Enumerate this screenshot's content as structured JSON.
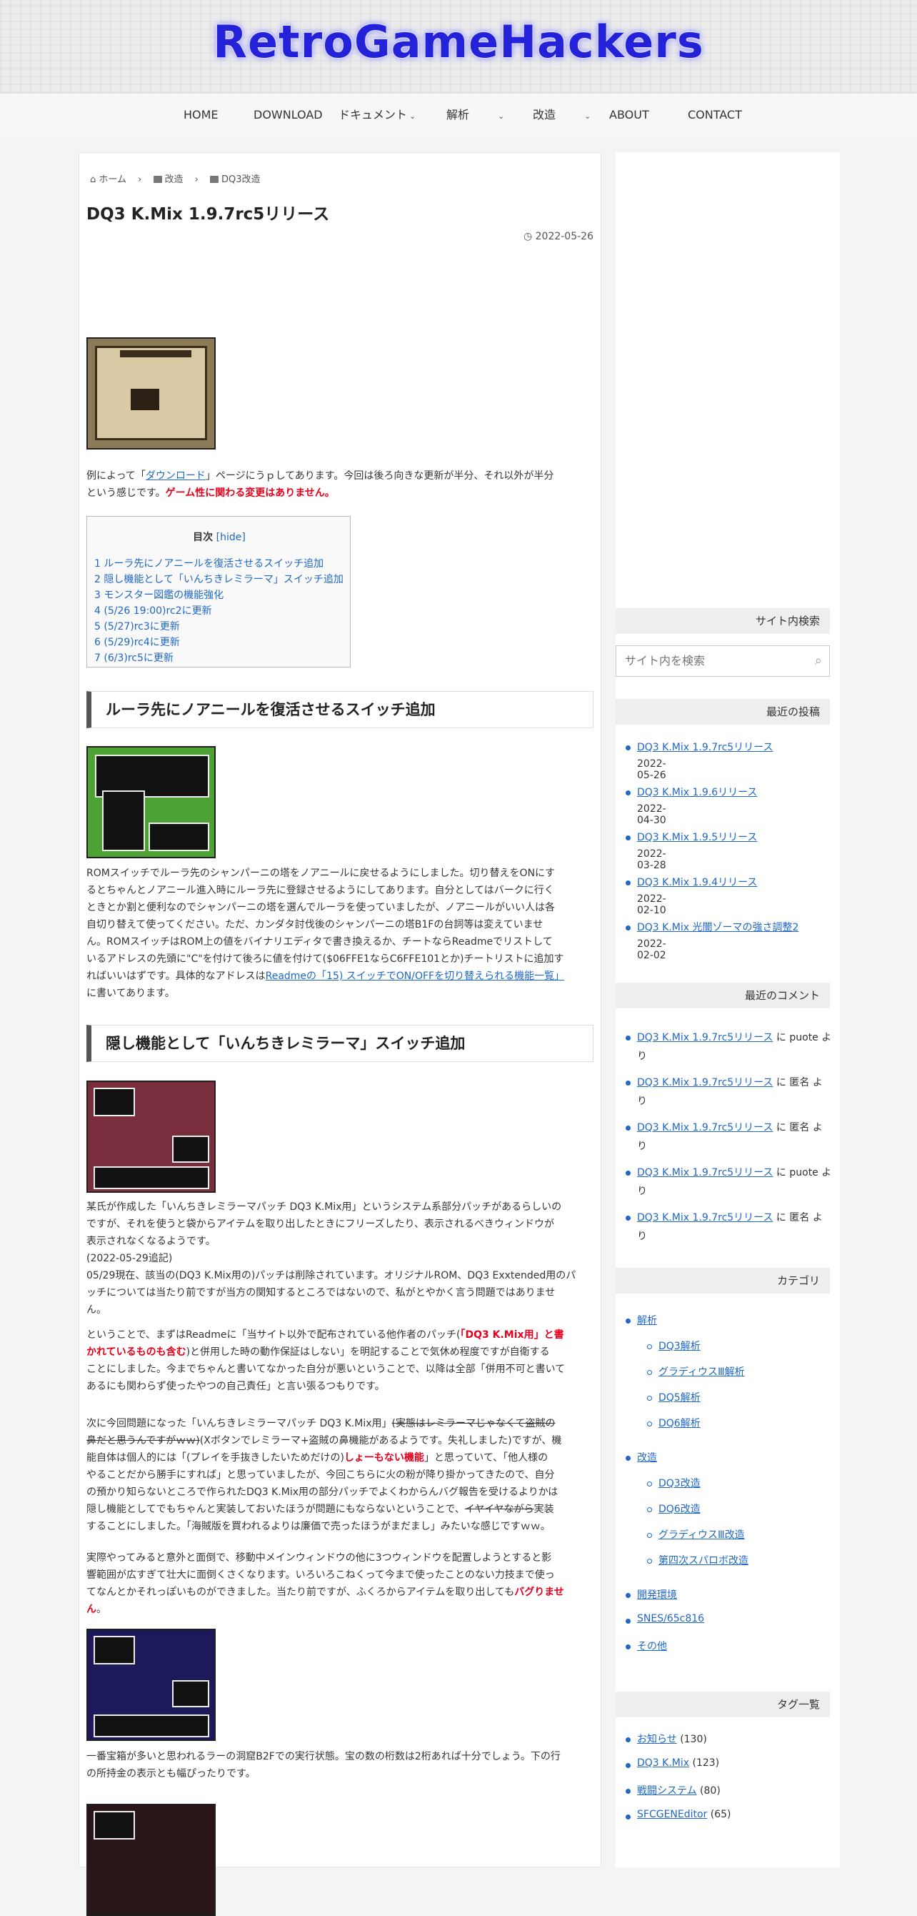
{
  "site": {
    "logo": "RetroGameHackers"
  },
  "nav": [
    {
      "label": "HOME"
    },
    {
      "label": "DOWNLOAD"
    },
    {
      "label": "ドキュメント"
    },
    {
      "label": "解析"
    },
    {
      "label": "改造"
    },
    {
      "label": "ABOUT"
    },
    {
      "label": "CONTACT"
    }
  ],
  "breadcrumb": {
    "home": "ホーム",
    "cat": "改造",
    "sub": "DQ3改造"
  },
  "post": {
    "title": "DQ3 K.Mix 1.9.7rc5リリース",
    "date": "2022-05-26",
    "intro_1": "例によって「",
    "intro_link": "ダウンロード",
    "intro_2": "」ページにうｐしてあります。今回は後ろ向きな更新が半分、それ以外が半分",
    "intro_3": "という感じです。",
    "intro_red": "ゲーム性に関わる変更はありません。",
    "toc": {
      "title": "目次",
      "hide": "[hide]",
      "items": [
        "1 ルーラ先にノアニールを復活させるスイッチ追加",
        "2 隠し機能として「いんちきレミラーマ」スイッチ追加",
        "3 モンスター図鑑の機能強化",
        "4 (5/26 19:00)rc2に更新",
        "5 (5/27)rc3に更新",
        "6 (5/29)rc4に更新",
        "7 (6/3)rc5に更新"
      ]
    },
    "h2_1": "ルーラ先にノアニールを復活させるスイッチ追加",
    "s1_lines": [
      "ROMスイッチでルーラ先のシャンパーニの塔をノアニールに戻せるようにしました。切り替えをONにす",
      "るとちゃんとノアニール進入時にルーラ先に登録させるようにしてあります。自分としてはバークに行く",
      "ときとか割と便利なのでシャンパーニの塔を選んでルーラを使っていましたが、ノアニールがいい人は各",
      "自切り替えて使ってください。ただ、カンダタ討伐後のシャンパーニの塔B1Fの台詞等は変えていませ",
      "ん。ROMスイッチはROM上の値をバイナリエディタで書き換えるか、チートならReadmeでリストして",
      "いるアドレスの先頭に\"C\"を付けて後ろに値を付けて($06FFE1ならC6FFE101とか)チートリストに追加す"
    ],
    "s1_l7a": "ればいいはずです。具体的なアドレスは",
    "s1_link": "Readmeの「15) スイッチでON/OFFを切り替えられる機能一覧」",
    "s1_l8": "に書いてあります。",
    "h2_2": "隠し機能として「いんちきレミラーマ」スイッチ追加",
    "s2_lines": [
      "某氏が作成した「いんちきレミラーマパッチ DQ3 K.Mix用」というシステム系部分パッチがあるらしいの",
      "ですが、それを使うと袋からアイテムを取り出したときにフリーズしたり、表示されるべきウィンドウが",
      "表示されなくなるようです。",
      "(2022-05-29追記)",
      "05/29現在、該当の(DQ3 K.Mix用の)パッチは削除されています。オリジナルROM、DQ3 Exxtended用のパ",
      "ッチについては当たり前ですが当方の関知するところではないので、私がとやかく言う問題ではありませ",
      "ん。"
    ],
    "s3_l1a": "ということで、まずはReadmeに「当サイト以外で配布されている他作者のパッチ(",
    "s3_l1red": "「DQ3 K.Mix用」と書",
    "s3_l2red": "かれているものも含む",
    "s3_l2b": ")と併用した時の動作保証はしない」を明記することで気休め程度ですが自衛する",
    "s3_l3": "ことにしました。今までちゃんと書いてなかった自分が悪いということで、以降は全部「併用不可と書いて",
    "s3_l4": "あるにも関わらず使ったやつの自己責任」と言い張るつもりです。",
    "s4_l1a": "次に今回問題になった「いんちきレミラーマパッチ DQ3 K.Mix用」",
    "s4_l1s": "(実態はレミラーマじゃなくて盗賊の",
    "s4_l2s": "鼻だと思うんですがｗｗ)",
    "s4_l2b": "(Xボタンでレミラーマ+盗賊の鼻機能があるようです。失礼しました)ですが、機",
    "s4_l3a": "能自体は個人的には「(プレイを手抜きしたいためだけの)",
    "s4_l3red": "しょーもない機能",
    "s4_l3b": "」と思っていて、「他人様の",
    "s4_l4": "やることだから勝手にすれば」と思っていましたが、今回こちらに火の粉が降り掛かってきたので、自分",
    "s4_l5": "の預かり知らないところで作られたDQ3 K.Mix用の部分パッチでよくわからんバグ報告を受けるよりかは",
    "s4_l6a": "隠し機能としてでもちゃんと実装しておいたほうが問題にもならないということで、",
    "s4_l6s": "イヤイヤながら",
    "s4_l6b": "実装",
    "s4_l7": "することにしました。「海賊版を買われるよりは廉価で売ったほうがまだまし」みたいな感じですｗｗ。",
    "s5_l1": "実際やってみると意外と面倒で、移動中メインウィンドウの他に3つウィンドウを配置しようとすると影",
    "s5_l2": "響範囲が広すぎて壮大に面倒くさくなります。いろいろこねくって今まで使ったことのない力技まで使っ",
    "s5_l3a": "てなんとかそれっぽいものができました。当たり前ですが、ふくろからアイテムを取り出しても",
    "s5_l3red": "バグりませ",
    "s5_l4red": "ん",
    "s5_l4b": "。",
    "s6_l1": "一番宝箱が多いと思われるラーの洞窟B2Fでの実行状態。宝の数の桁数は2桁あれば十分でしょう。下の行",
    "s6_l2": "の所持金の表示とも幅ぴったりです。"
  },
  "sidebar": {
    "search_head": "サイト内検索",
    "search_placeholder": "サイト内を検索",
    "recent_head": "最近の投稿",
    "recent": [
      {
        "title": "DQ3 K.Mix 1.9.7rc5リリース",
        "date": "2022-05-26"
      },
      {
        "title": "DQ3 K.Mix 1.9.6リリース",
        "date": "2022-04-30"
      },
      {
        "title": "DQ3 K.Mix 1.9.5リリース",
        "date": "2022-03-28"
      },
      {
        "title": "DQ3 K.Mix 1.9.4リリース",
        "date": "2022-02-10"
      },
      {
        "title": "DQ3 K.Mix 光闇ゾーマの強さ調整2",
        "date": "2022-02-02"
      }
    ],
    "comments_head": "最近のコメント",
    "comments": [
      {
        "link": "DQ3 K.Mix 1.9.7rc5リリース",
        "by": "に puote よ",
        "tail": "り"
      },
      {
        "link": "DQ3 K.Mix 1.9.7rc5リリース",
        "by": "に 匿名 よ",
        "tail": "り"
      },
      {
        "link": "DQ3 K.Mix 1.9.7rc5リリース",
        "by": "に 匿名 よ",
        "tail": "り"
      },
      {
        "link": "DQ3 K.Mix 1.9.7rc5リリース",
        "by": "に puote よ",
        "tail": "り"
      },
      {
        "link": "DQ3 K.Mix 1.9.7rc5リリース",
        "by": "に 匿名 よ",
        "tail": "り"
      }
    ],
    "cat_head": "カテゴリ",
    "cats": {
      "analysis": "解析",
      "analysis_sub": [
        "DQ3解析",
        "グラディウスⅢ解析",
        "DQ5解析",
        "DQ6解析"
      ],
      "mod": "改造",
      "mod_sub": [
        "DQ3改造",
        "DQ6改造",
        "グラディウスⅢ改造",
        "第四次スパロボ改造"
      ],
      "dev": "開発環境",
      "snes": "SNES/65c816",
      "other": "その他"
    },
    "tag_head": "タグ一覧",
    "tags": [
      {
        "name": "お知らせ",
        "count": "(130)"
      },
      {
        "name": "DQ3 K.Mix",
        "count": "(123)"
      },
      {
        "name": "戦闘システム",
        "count": "(80)"
      },
      {
        "name": "SFCGENEditor",
        "count": "(65)"
      }
    ]
  }
}
